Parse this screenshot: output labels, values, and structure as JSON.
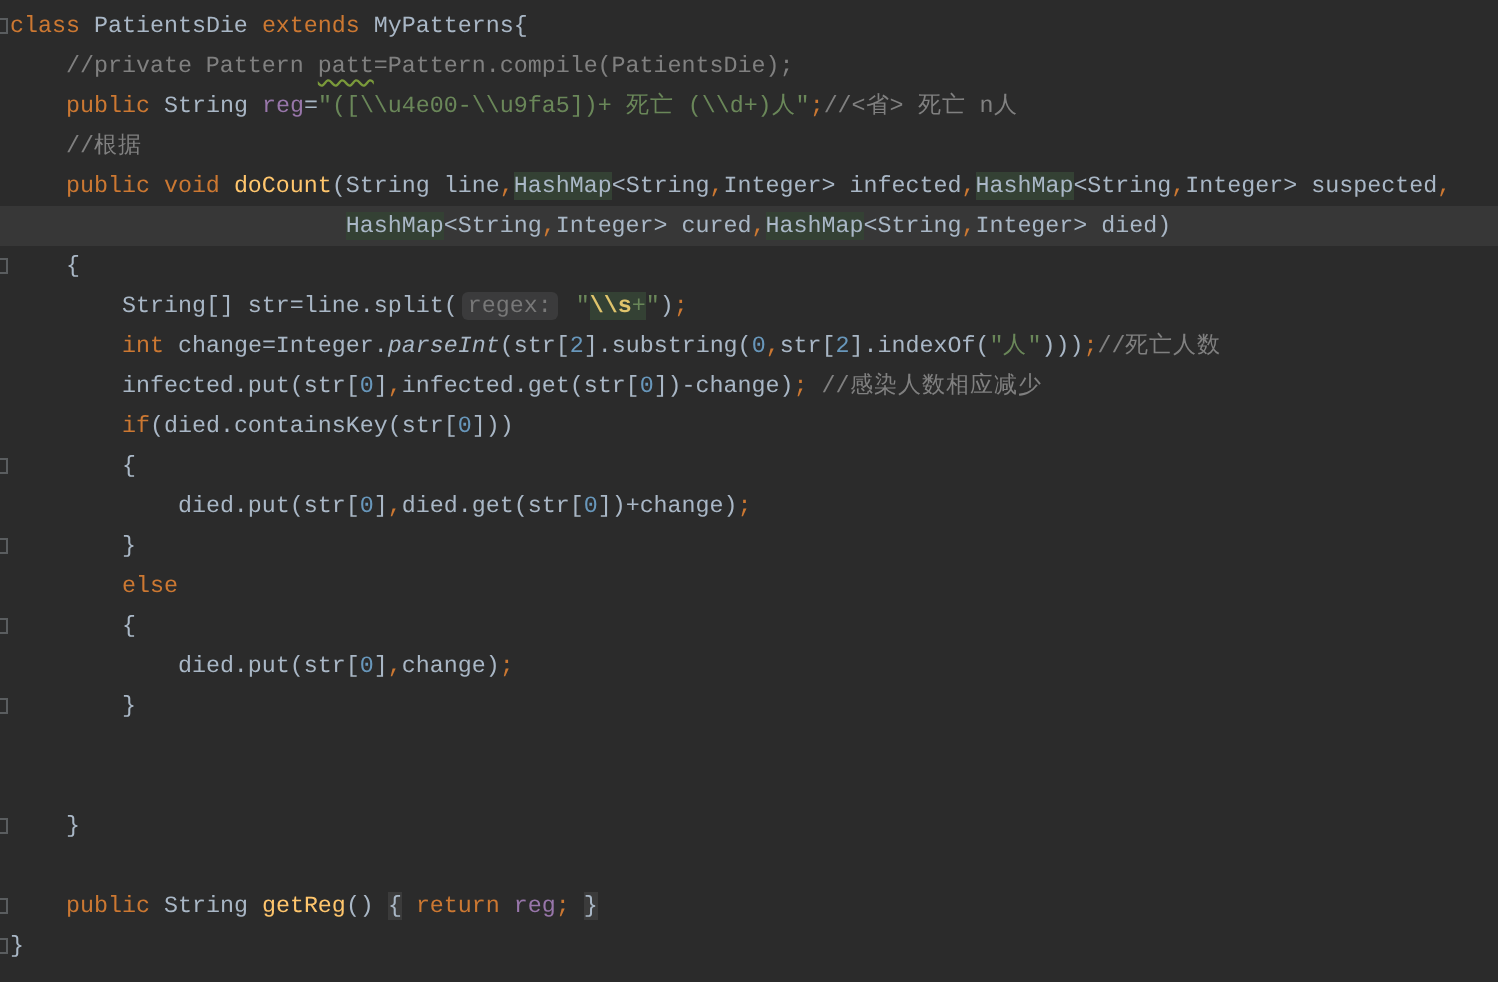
{
  "editor": {
    "lines": [
      {
        "current": false,
        "fold": true,
        "tokens": [
          {
            "text": "class",
            "kind": "kw"
          },
          {
            "text": " PatientsDie ",
            "kind": "plain"
          },
          {
            "text": "extends",
            "kind": "kw"
          },
          {
            "text": " MyPatterns{",
            "kind": "plain"
          }
        ]
      },
      {
        "current": false,
        "fold": false,
        "tokens": [
          {
            "text": "    //private Pattern ",
            "kind": "cmt"
          },
          {
            "text": "patt",
            "kind": "cmt-typo"
          },
          {
            "text": "=Pattern.compile(PatientsDie);",
            "kind": "cmt"
          }
        ]
      },
      {
        "current": false,
        "fold": false,
        "tokens": [
          {
            "text": "    public",
            "kind": "kw"
          },
          {
            "text": " String ",
            "kind": "plain"
          },
          {
            "text": "reg",
            "kind": "field"
          },
          {
            "text": "=",
            "kind": "plain"
          },
          {
            "text": "\"([\\\\u4e00-\\\\u9fa5])+ 死亡 (\\\\d+)人\"",
            "kind": "str"
          },
          {
            "text": ";",
            "kind": "kw"
          },
          {
            "text": "//<省> 死亡 n人",
            "kind": "cmt"
          }
        ]
      },
      {
        "current": false,
        "fold": false,
        "tokens": [
          {
            "text": "    //根据",
            "kind": "cmt"
          }
        ]
      },
      {
        "current": false,
        "fold": false,
        "tokens": [
          {
            "text": "    public void ",
            "kind": "kw"
          },
          {
            "text": "doCount",
            "kind": "fn"
          },
          {
            "text": "(String line",
            "kind": "plain"
          },
          {
            "text": ",",
            "kind": "kw"
          },
          {
            "text": "HashMap",
            "kind": "plain-usage"
          },
          {
            "text": "<String",
            "kind": "plain"
          },
          {
            "text": ",",
            "kind": "kw"
          },
          {
            "text": "Integer> infected",
            "kind": "plain"
          },
          {
            "text": ",",
            "kind": "kw"
          },
          {
            "text": "HashMap",
            "kind": "plain-usage"
          },
          {
            "text": "<String",
            "kind": "plain"
          },
          {
            "text": ",",
            "kind": "kw"
          },
          {
            "text": "Integer> suspected",
            "kind": "plain"
          },
          {
            "text": ",",
            "kind": "kw"
          }
        ]
      },
      {
        "current": true,
        "fold": false,
        "tokens": [
          {
            "text": "                        HashMap",
            "kind": "plain-usage"
          },
          {
            "text": "<String",
            "kind": "plain"
          },
          {
            "text": ",",
            "kind": "kw"
          },
          {
            "text": "Integer> cured",
            "kind": "plain"
          },
          {
            "text": ",",
            "kind": "kw"
          },
          {
            "text": "HashMap",
            "kind": "plain-usage"
          },
          {
            "text": "<String",
            "kind": "plain"
          },
          {
            "text": ",",
            "kind": "kw"
          },
          {
            "text": "Integer> died)",
            "kind": "plain"
          }
        ]
      },
      {
        "current": false,
        "fold": true,
        "tokens": [
          {
            "text": "    {",
            "kind": "plain"
          }
        ]
      },
      {
        "current": false,
        "fold": false,
        "tokens": [
          {
            "text": "        String[] str=line.split(",
            "kind": "plain"
          },
          {
            "text": "regex:",
            "kind": "hint"
          },
          {
            "text": " \"",
            "kind": "str"
          },
          {
            "text": "\\\\s",
            "kind": "esc-usage"
          },
          {
            "text": "+",
            "kind": "str-usage"
          },
          {
            "text": "\"",
            "kind": "str"
          },
          {
            "text": ")",
            "kind": "plain"
          },
          {
            "text": ";",
            "kind": "kw"
          }
        ]
      },
      {
        "current": false,
        "fold": false,
        "tokens": [
          {
            "text": "        int",
            "kind": "kw"
          },
          {
            "text": " change=Integer.",
            "kind": "plain"
          },
          {
            "text": "parseInt",
            "kind": "static"
          },
          {
            "text": "(str[",
            "kind": "plain"
          },
          {
            "text": "2",
            "kind": "num"
          },
          {
            "text": "].substring(",
            "kind": "plain"
          },
          {
            "text": "0",
            "kind": "num"
          },
          {
            "text": ",",
            "kind": "kw"
          },
          {
            "text": "str[",
            "kind": "plain"
          },
          {
            "text": "2",
            "kind": "num"
          },
          {
            "text": "].indexOf(",
            "kind": "plain"
          },
          {
            "text": "\"人\"",
            "kind": "str"
          },
          {
            "text": ")))",
            "kind": "plain"
          },
          {
            "text": ";",
            "kind": "kw"
          },
          {
            "text": "//死亡人数",
            "kind": "cmt"
          }
        ]
      },
      {
        "current": false,
        "fold": false,
        "tokens": [
          {
            "text": "        infected.put(str[",
            "kind": "plain"
          },
          {
            "text": "0",
            "kind": "num"
          },
          {
            "text": "]",
            "kind": "plain"
          },
          {
            "text": ",",
            "kind": "kw"
          },
          {
            "text": "infected.get(str[",
            "kind": "plain"
          },
          {
            "text": "0",
            "kind": "num"
          },
          {
            "text": "])-change)",
            "kind": "plain"
          },
          {
            "text": ";",
            "kind": "kw"
          },
          {
            "text": " //感染人数相应减少",
            "kind": "cmt"
          }
        ]
      },
      {
        "current": false,
        "fold": false,
        "tokens": [
          {
            "text": "        if",
            "kind": "kw"
          },
          {
            "text": "(died.containsKey(str[",
            "kind": "plain"
          },
          {
            "text": "0",
            "kind": "num"
          },
          {
            "text": "]))",
            "kind": "plain"
          }
        ]
      },
      {
        "current": false,
        "fold": true,
        "tokens": [
          {
            "text": "        {",
            "kind": "plain"
          }
        ]
      },
      {
        "current": false,
        "fold": false,
        "tokens": [
          {
            "text": "            died.put(str[",
            "kind": "plain"
          },
          {
            "text": "0",
            "kind": "num"
          },
          {
            "text": "]",
            "kind": "plain"
          },
          {
            "text": ",",
            "kind": "kw"
          },
          {
            "text": "died.get(str[",
            "kind": "plain"
          },
          {
            "text": "0",
            "kind": "num"
          },
          {
            "text": "])+change)",
            "kind": "plain"
          },
          {
            "text": ";",
            "kind": "kw"
          }
        ]
      },
      {
        "current": false,
        "fold": true,
        "tokens": [
          {
            "text": "        }",
            "kind": "plain"
          }
        ]
      },
      {
        "current": false,
        "fold": false,
        "tokens": [
          {
            "text": "        else",
            "kind": "kw"
          }
        ]
      },
      {
        "current": false,
        "fold": true,
        "tokens": [
          {
            "text": "        {",
            "kind": "plain"
          }
        ]
      },
      {
        "current": false,
        "fold": false,
        "tokens": [
          {
            "text": "            died.put(str[",
            "kind": "plain"
          },
          {
            "text": "0",
            "kind": "num"
          },
          {
            "text": "]",
            "kind": "plain"
          },
          {
            "text": ",",
            "kind": "kw"
          },
          {
            "text": "change)",
            "kind": "plain"
          },
          {
            "text": ";",
            "kind": "kw"
          }
        ]
      },
      {
        "current": false,
        "fold": true,
        "tokens": [
          {
            "text": "        }",
            "kind": "plain"
          }
        ]
      },
      {
        "current": false,
        "fold": false
      },
      {
        "current": false,
        "fold": false
      },
      {
        "current": false,
        "fold": true,
        "tokens": [
          {
            "text": "    }",
            "kind": "plain"
          }
        ]
      },
      {
        "current": false,
        "fold": false
      },
      {
        "current": false,
        "fold": true,
        "tokens": [
          {
            "text": "    public",
            "kind": "kw"
          },
          {
            "text": " String ",
            "kind": "plain"
          },
          {
            "text": "getReg",
            "kind": "fn"
          },
          {
            "text": "() ",
            "kind": "plain"
          },
          {
            "text": "{",
            "kind": "brace-match"
          },
          {
            "text": " return",
            "kind": "kw"
          },
          {
            "text": " reg",
            "kind": "field"
          },
          {
            "text": "; ",
            "kind": "kw"
          },
          {
            "text": "}",
            "kind": "brace-match"
          }
        ]
      },
      {
        "current": false,
        "fold": true,
        "tokens": [
          {
            "text": "}",
            "kind": "plain"
          }
        ]
      }
    ]
  }
}
